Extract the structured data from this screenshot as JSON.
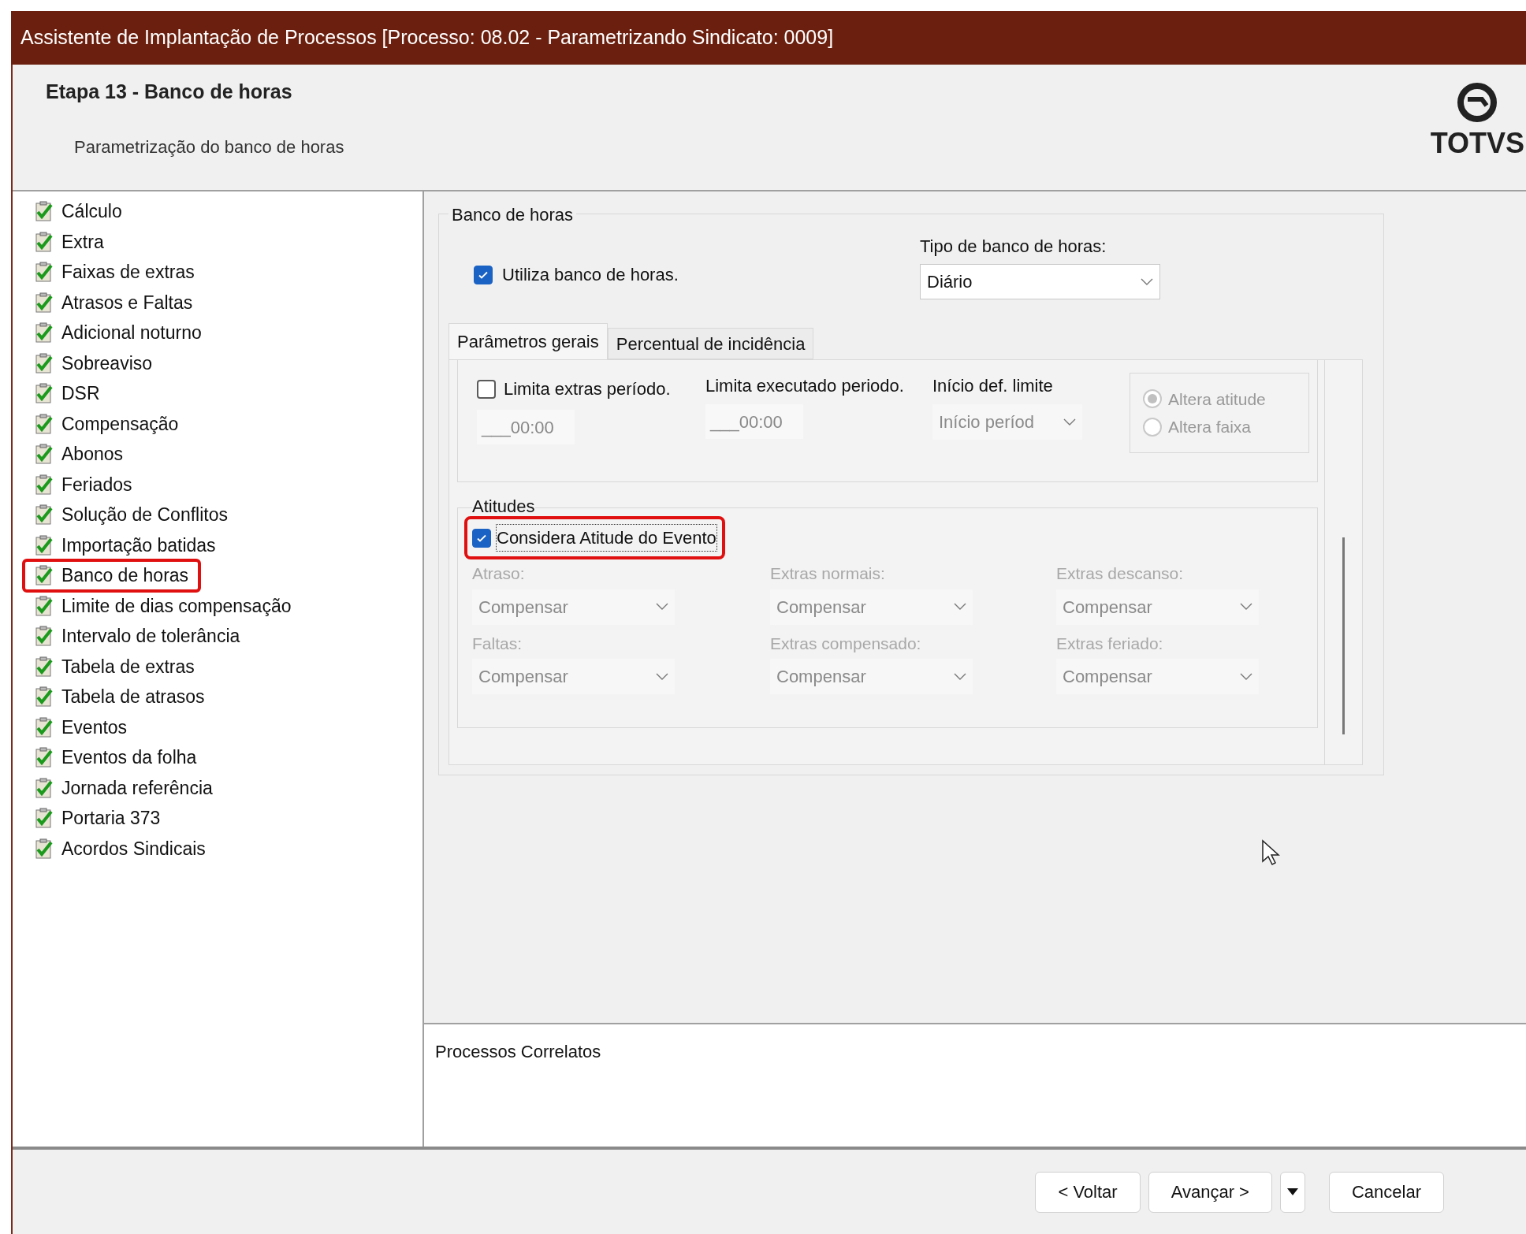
{
  "window": {
    "title": "Assistente de Implantação de Processos [Processo: 08.02 - Parametrizando Sindicato: 0009]"
  },
  "header": {
    "step_title": "Etapa 13 - Banco de horas",
    "subtitle": "Parametrização do banco de horas",
    "logo_text": "TOTVS"
  },
  "sidebar": {
    "items": [
      {
        "label": "Cálculo",
        "completed": true,
        "highlighted": false
      },
      {
        "label": "Extra",
        "completed": true,
        "highlighted": false
      },
      {
        "label": "Faixas de extras",
        "completed": true,
        "highlighted": false
      },
      {
        "label": "Atrasos e Faltas",
        "completed": true,
        "highlighted": false
      },
      {
        "label": "Adicional noturno",
        "completed": true,
        "highlighted": false
      },
      {
        "label": "Sobreaviso",
        "completed": true,
        "highlighted": false
      },
      {
        "label": "DSR",
        "completed": true,
        "highlighted": false
      },
      {
        "label": "Compensação",
        "completed": true,
        "highlighted": false
      },
      {
        "label": "Abonos",
        "completed": true,
        "highlighted": false
      },
      {
        "label": "Feriados",
        "completed": true,
        "highlighted": false
      },
      {
        "label": "Solução de Conflitos",
        "completed": true,
        "highlighted": false
      },
      {
        "label": "Importação batidas",
        "completed": true,
        "highlighted": false
      },
      {
        "label": "Banco de horas",
        "completed": true,
        "highlighted": true
      },
      {
        "label": "Limite de dias compensação",
        "completed": true,
        "highlighted": false
      },
      {
        "label": "Intervalo de tolerância",
        "completed": true,
        "highlighted": false
      },
      {
        "label": "Tabela de extras",
        "completed": true,
        "highlighted": false
      },
      {
        "label": "Tabela de atrasos",
        "completed": true,
        "highlighted": false
      },
      {
        "label": "Eventos",
        "completed": true,
        "highlighted": false
      },
      {
        "label": "Eventos da folha",
        "completed": true,
        "highlighted": false
      },
      {
        "label": "Jornada referência",
        "completed": true,
        "highlighted": false
      },
      {
        "label": "Portaria 373",
        "completed": true,
        "highlighted": false
      },
      {
        "label": "Acordos Sindicais",
        "completed": true,
        "highlighted": false
      }
    ]
  },
  "group": {
    "title": "Banco de horas",
    "use_checkbox": {
      "label": "Utiliza banco de horas.",
      "checked": true
    },
    "type_field": {
      "label": "Tipo de banco de horas:",
      "value": "Diário"
    },
    "tabs": [
      {
        "label": "Parâmetros gerais",
        "selected": true
      },
      {
        "label": "Percentual de incidência",
        "selected": false
      }
    ],
    "limits": {
      "extras": {
        "label": "Limita extras período.",
        "checked": false,
        "value": "___00:00"
      },
      "executed": {
        "label": "Limita executado periodo.",
        "value": "___00:00"
      },
      "start": {
        "label": "Início def. limite",
        "value": "Início períod"
      },
      "radios": [
        {
          "label": "Altera atitude",
          "selected": true
        },
        {
          "label": "Altera faixa",
          "selected": false
        }
      ]
    },
    "attitudes": {
      "title": "Atitudes",
      "consider": {
        "label": "Considera Atitude do Evento",
        "checked": true,
        "highlighted": true
      },
      "fields": [
        {
          "label": "Atraso:",
          "value": "Compensar",
          "disabled": true
        },
        {
          "label": "Extras normais:",
          "value": "Compensar",
          "disabled": true
        },
        {
          "label": "Extras descanso:",
          "value": "Compensar",
          "disabled": true
        },
        {
          "label": "Faltas:",
          "value": "Compensar",
          "disabled": true
        },
        {
          "label": "Extras compensado:",
          "value": "Compensar",
          "disabled": true
        },
        {
          "label": "Extras feriado:",
          "value": "Compensar",
          "disabled": true
        }
      ]
    }
  },
  "related": {
    "title": "Processos Correlatos"
  },
  "buttons": [
    {
      "kind": "button",
      "label": "< Voltar"
    },
    {
      "kind": "button",
      "label": "Avançar >"
    },
    {
      "kind": "menu"
    },
    {
      "kind": "gap"
    },
    {
      "kind": "button",
      "label": "Cancelar"
    }
  ]
}
